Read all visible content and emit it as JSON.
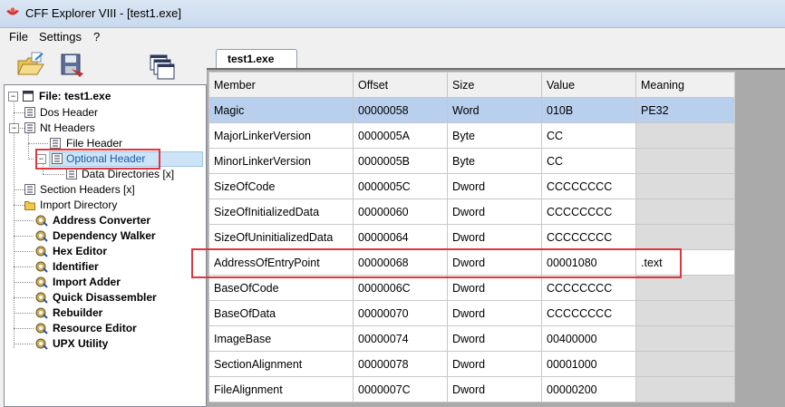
{
  "window": {
    "title": "CFF Explorer VIII - [test1.exe]"
  },
  "menu": [
    "File",
    "Settings",
    "?"
  ],
  "tree": {
    "root": "File: test1.exe",
    "items": [
      {
        "label": "Dos Header"
      },
      {
        "label": "Nt Headers"
      },
      {
        "label": "File Header"
      },
      {
        "label": "Optional Header"
      },
      {
        "label": "Data Directories [x]"
      },
      {
        "label": "Section Headers [x]"
      },
      {
        "label": "Import Directory"
      },
      {
        "label": "Address Converter"
      },
      {
        "label": "Dependency Walker"
      },
      {
        "label": "Hex Editor"
      },
      {
        "label": "Identifier"
      },
      {
        "label": "Import Adder"
      },
      {
        "label": "Quick Disassembler"
      },
      {
        "label": "Rebuilder"
      },
      {
        "label": "Resource Editor"
      },
      {
        "label": "UPX Utility"
      }
    ]
  },
  "tab": {
    "label": "test1.exe"
  },
  "table": {
    "headers": [
      "Member",
      "Offset",
      "Size",
      "Value",
      "Meaning"
    ],
    "rows": [
      [
        "Magic",
        "00000058",
        "Word",
        "010B",
        "PE32"
      ],
      [
        "MajorLinkerVersion",
        "0000005A",
        "Byte",
        "CC",
        ""
      ],
      [
        "MinorLinkerVersion",
        "0000005B",
        "Byte",
        "CC",
        ""
      ],
      [
        "SizeOfCode",
        "0000005C",
        "Dword",
        "CCCCCCCC",
        ""
      ],
      [
        "SizeOfInitializedData",
        "00000060",
        "Dword",
        "CCCCCCCC",
        ""
      ],
      [
        "SizeOfUninitializedData",
        "00000064",
        "Dword",
        "CCCCCCCC",
        ""
      ],
      [
        "AddressOfEntryPoint",
        "00000068",
        "Dword",
        "00001080",
        ".text"
      ],
      [
        "BaseOfCode",
        "0000006C",
        "Dword",
        "CCCCCCCC",
        ""
      ],
      [
        "BaseOfData",
        "00000070",
        "Dword",
        "CCCCCCCC",
        ""
      ],
      [
        "ImageBase",
        "00000074",
        "Dword",
        "00400000",
        ""
      ],
      [
        "SectionAlignment",
        "00000078",
        "Dword",
        "00001000",
        ""
      ],
      [
        "FileAlignment",
        "0000007C",
        "Dword",
        "00000200",
        ""
      ]
    ]
  }
}
